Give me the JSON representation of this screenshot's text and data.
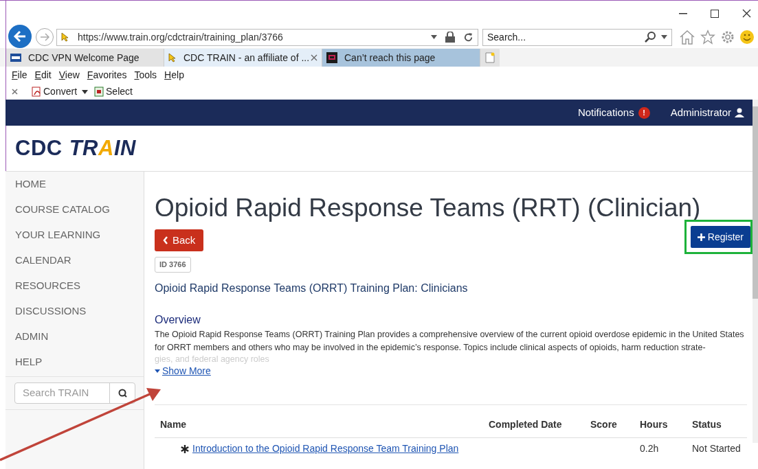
{
  "browser": {
    "address": "https://www.train.org/cdctrain/training_plan/3766",
    "search": {
      "placeholder": "Search..."
    },
    "tabs": [
      {
        "label": "CDC VPN Welcome Page",
        "selected": false,
        "highlighted": false
      },
      {
        "label": "CDC TRAIN - an affiliate of ...",
        "selected": true,
        "highlighted": false
      },
      {
        "label": "Can’t reach this page",
        "selected": false,
        "highlighted": true
      }
    ],
    "menu": [
      "File",
      "Edit",
      "View",
      "Favorites",
      "Tools",
      "Help"
    ],
    "toolbar": [
      "Convert",
      "Select"
    ]
  },
  "navbar": {
    "notifications": "Notifications",
    "badge": "!",
    "user": "Administrator"
  },
  "logo": {
    "first": "CDC",
    "second": "TRAIN"
  },
  "sidebar": {
    "items": [
      "HOME",
      "COURSE CATALOG",
      "YOUR LEARNING",
      "CALENDAR",
      "RESOURCES",
      "DISCUSSIONS",
      "ADMIN",
      "HELP"
    ],
    "search": {
      "placeholder": "Search TRAIN"
    }
  },
  "main": {
    "title": "Opioid Rapid Response Teams (RRT) (Clinician)",
    "back": "Back",
    "register": "Register",
    "id": "ID 3766",
    "subtitle": "Opioid Rapid Response Teams (ORRT) Training Plan: Clinicians",
    "overview_heading": "Overview",
    "overview": "The Opioid Rapid Response Teams (ORRT) Training Plan provides a comprehensive overview of the current opioid overdose epidemic in the United States for ORRT members and others who may be involved in the epidemic’s response. Topics include clinical aspects of opioids, harm reduction strate-",
    "overview_faded": "gies, and federal agency roles",
    "show_more": "Show More",
    "table": {
      "columns": [
        "Name",
        "Completed Date",
        "Score",
        "Hours",
        "Status"
      ],
      "rows": [
        {
          "name": "Introduction to the Opioid Rapid Response Team Training Plan",
          "hours": "0.2h",
          "status": "Not Started"
        }
      ]
    }
  }
}
